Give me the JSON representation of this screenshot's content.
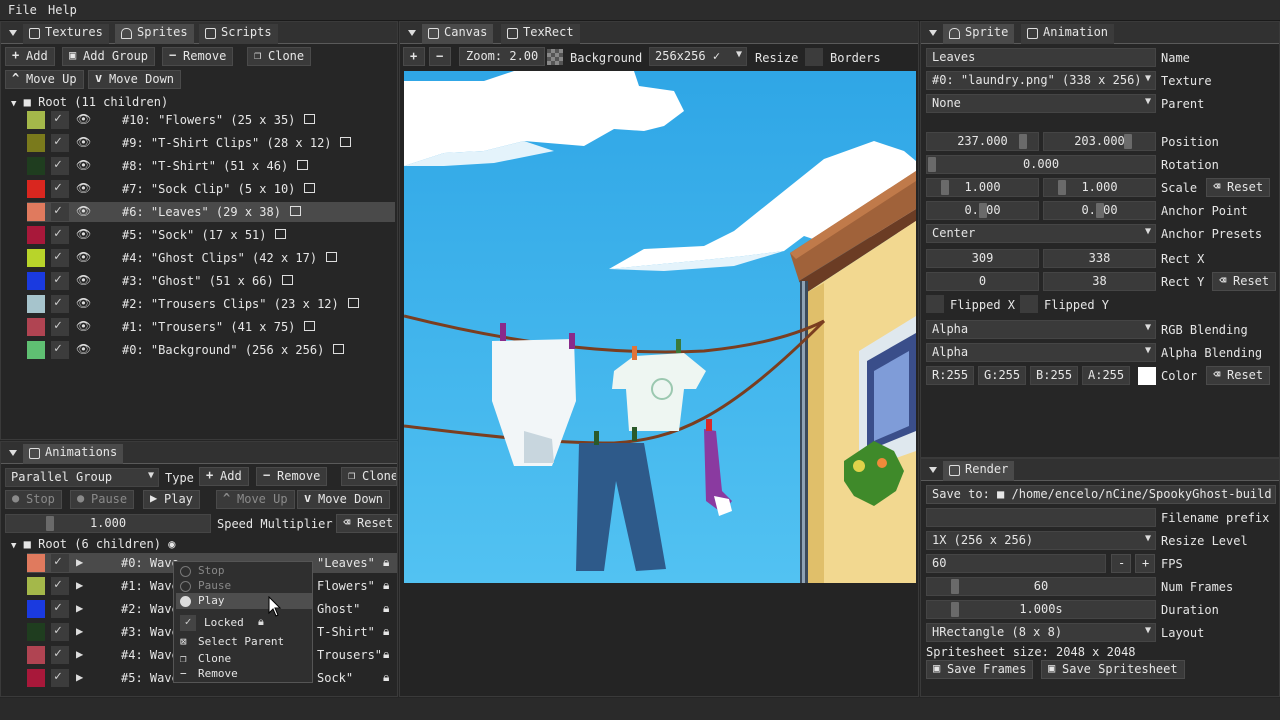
{
  "menu": {
    "file": "File",
    "help": "Help"
  },
  "left_top": {
    "tabs": [
      "Textures",
      "Sprites",
      "Scripts"
    ],
    "buttons": {
      "add": "Add",
      "add_group": "Add Group",
      "remove": "Remove",
      "clone": "Clone",
      "move_up": "Move Up",
      "move_down": "Move Down"
    },
    "root": "Root (11 children)",
    "sprites": [
      {
        "label": "#10: \"Flowers\" (25 x 35)",
        "color": "#a4b84a"
      },
      {
        "label": "#9: \"T-Shirt Clips\" (28 x 12)",
        "color": "#7a7a1c"
      },
      {
        "label": "#8: \"T-Shirt\" (51 x 46)",
        "color": "#1f3d1f"
      },
      {
        "label": "#7: \"Sock Clip\" (5 x 10)",
        "color": "#d9261f"
      },
      {
        "label": "#6: \"Leaves\" (29 x 38)",
        "color": "#e07a5e"
      },
      {
        "label": "#5: \"Sock\" (17 x 51)",
        "color": "#a8183a"
      },
      {
        "label": "#4: \"Ghost Clips\" (42 x 17)",
        "color": "#b8d42a"
      },
      {
        "label": "#3: \"Ghost\" (51 x 66)",
        "color": "#1a3ae0"
      },
      {
        "label": "#2: \"Trousers Clips\" (23 x 12)",
        "color": "#a6c4cc"
      },
      {
        "label": "#1: \"Trousers\" (41 x 75)",
        "color": "#b04452"
      },
      {
        "label": "#0: \"Background\" (256 x 256)",
        "color": "#5fbf72"
      }
    ]
  },
  "anim": {
    "title": "Animations",
    "type_value": "Parallel Group",
    "type_label": "Type",
    "buttons": {
      "add": "Add",
      "remove": "Remove",
      "clone": "Clone",
      "stop": "Stop",
      "pause": "Pause",
      "play": "Play",
      "move_up": "Move Up",
      "move_down": "Move Down",
      "reset": "Reset"
    },
    "speed": "1.000",
    "speed_label": "Speed Multiplier",
    "root": "Root (6 children)",
    "items": [
      {
        "prefix": "#0: Wave",
        "suffix": "\"Leaves\"",
        "color": "#e07a5e"
      },
      {
        "prefix": "#1: Wave",
        "suffix": "Flowers\"",
        "color": "#a4b84a"
      },
      {
        "prefix": "#2: Wave",
        "suffix": "Ghost\"",
        "color": "#1a3ae0"
      },
      {
        "prefix": "#3: Wave",
        "suffix": "T-Shirt\"",
        "color": "#1f3d1f"
      },
      {
        "prefix": "#4: Wave",
        "suffix": "Trousers\"",
        "color": "#b04452"
      },
      {
        "prefix": "#5: Wave",
        "suffix": "Sock\"",
        "color": "#a8183a"
      }
    ],
    "context": {
      "stop": "Stop",
      "pause": "Pause",
      "play": "Play",
      "locked": "Locked",
      "select_parent": "Select Parent",
      "clone": "Clone",
      "remove": "Remove"
    }
  },
  "canvas": {
    "tabs": [
      "Canvas",
      "TexRect"
    ],
    "zoom": "Zoom: 2.00",
    "background": "Background",
    "size": "256x256",
    "resize": "Resize",
    "borders": "Borders"
  },
  "sprite": {
    "tabs": [
      "Sprite",
      "Animation"
    ],
    "name": "Leaves",
    "name_label": "Name",
    "texture": "#0: \"laundry.png\" (338 x 256)",
    "texture_label": "Texture",
    "parent": "None",
    "parent_label": "Parent",
    "pos_x": "237.000",
    "pos_y": "203.000",
    "pos_label": "Position",
    "rotation": "0.000",
    "rotation_label": "Rotation",
    "scale_x": "1.000",
    "scale_y": "1.000",
    "scale_label": "Scale",
    "reset": "Reset",
    "anchor_x": "0.000",
    "anchor_y": "0.000",
    "anchor_label": "Anchor Point",
    "anchor_preset": "Center",
    "anchor_preset_label": "Anchor Presets",
    "rect_x1": "309",
    "rect_x2": "338",
    "rect_x_label": "Rect X",
    "rect_y1": "0",
    "rect_y2": "38",
    "rect_y_label": "Rect Y",
    "flipped_x": "Flipped X",
    "flipped_y": "Flipped Y",
    "rgb_blend": "Alpha",
    "rgb_blend_label": "RGB Blending",
    "alpha_blend": "Alpha",
    "alpha_blend_label": "Alpha Blending",
    "r": "R:255",
    "g": "G:255",
    "b": "B:255",
    "a": "A:255",
    "color_label": "Color"
  },
  "render": {
    "title": "Render",
    "save_to": "Save to:",
    "path": "/home/encelo/nCine/SpookyGhost-build",
    "prefix_label": "Filename prefix",
    "resize_level": "1X (256 x 256)",
    "resize_label": "Resize Level",
    "fps": "60",
    "fps_label": "FPS",
    "minus": "-",
    "plus": "+",
    "frames": "60",
    "frames_label": "Num Frames",
    "duration": "1.000s",
    "duration_label": "Duration",
    "layout": "HRectangle (8 x 8)",
    "layout_label": "Layout",
    "sheet_size": "Spritesheet size: 2048 x 2048",
    "save_frames": "Save Frames",
    "save_sheet": "Save Spritesheet"
  }
}
